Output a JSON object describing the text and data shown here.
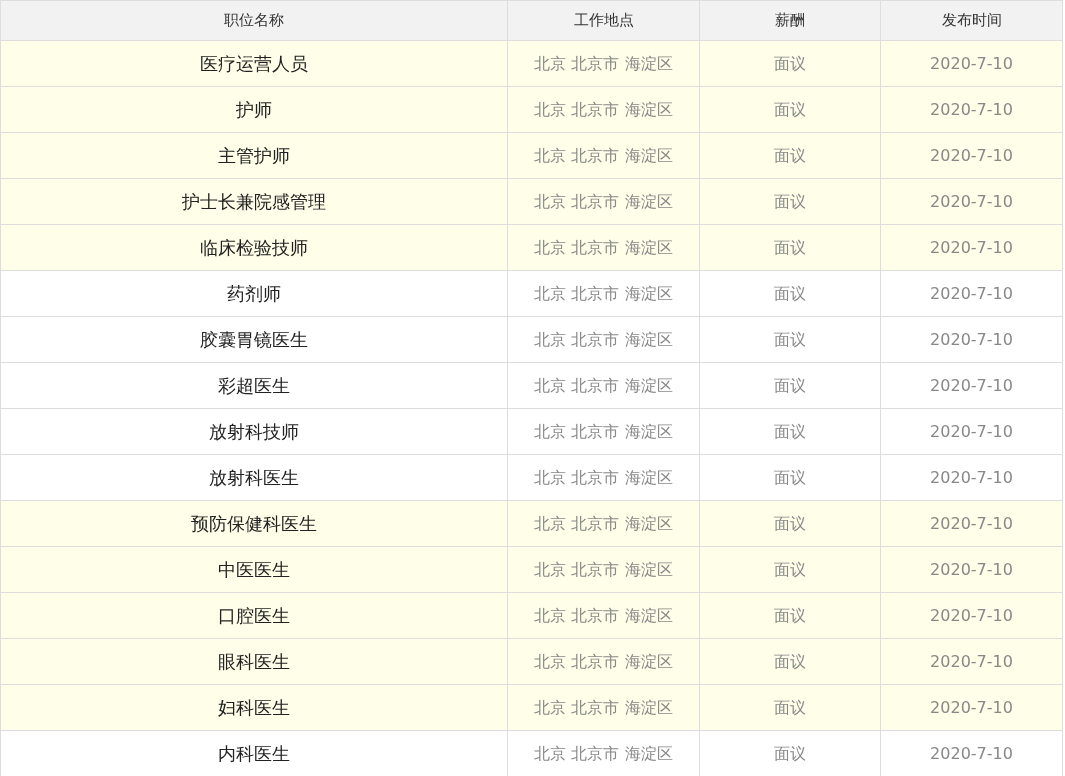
{
  "table": {
    "columns": [
      "职位名称",
      "工作地点",
      "薪酬",
      "发布时间"
    ],
    "rows": [
      {
        "title": "医疗运营人员",
        "location": "北京 北京市 海淀区",
        "salary": "面议",
        "date": "2020-7-10",
        "highlighted": true
      },
      {
        "title": "护师",
        "location": "北京 北京市 海淀区",
        "salary": "面议",
        "date": "2020-7-10",
        "highlighted": true
      },
      {
        "title": "主管护师",
        "location": "北京 北京市 海淀区",
        "salary": "面议",
        "date": "2020-7-10",
        "highlighted": true
      },
      {
        "title": "护士长兼院感管理",
        "location": "北京 北京市 海淀区",
        "salary": "面议",
        "date": "2020-7-10",
        "highlighted": true
      },
      {
        "title": "临床检验技师",
        "location": "北京 北京市 海淀区",
        "salary": "面议",
        "date": "2020-7-10",
        "highlighted": true
      },
      {
        "title": "药剂师",
        "location": "北京 北京市 海淀区",
        "salary": "面议",
        "date": "2020-7-10",
        "highlighted": false
      },
      {
        "title": "胶囊胃镜医生",
        "location": "北京 北京市 海淀区",
        "salary": "面议",
        "date": "2020-7-10",
        "highlighted": false
      },
      {
        "title": "彩超医生",
        "location": "北京 北京市 海淀区",
        "salary": "面议",
        "date": "2020-7-10",
        "highlighted": false
      },
      {
        "title": "放射科技师",
        "location": "北京 北京市 海淀区",
        "salary": "面议",
        "date": "2020-7-10",
        "highlighted": false
      },
      {
        "title": "放射科医生",
        "location": "北京 北京市 海淀区",
        "salary": "面议",
        "date": "2020-7-10",
        "highlighted": false
      },
      {
        "title": "预防保健科医生",
        "location": "北京 北京市 海淀区",
        "salary": "面议",
        "date": "2020-7-10",
        "highlighted": true
      },
      {
        "title": "中医医生",
        "location": "北京 北京市 海淀区",
        "salary": "面议",
        "date": "2020-7-10",
        "highlighted": true
      },
      {
        "title": "口腔医生",
        "location": "北京 北京市 海淀区",
        "salary": "面议",
        "date": "2020-7-10",
        "highlighted": true
      },
      {
        "title": "眼科医生",
        "location": "北京 北京市 海淀区",
        "salary": "面议",
        "date": "2020-7-10",
        "highlighted": true
      },
      {
        "title": "妇科医生",
        "location": "北京 北京市 海淀区",
        "salary": "面议",
        "date": "2020-7-10",
        "highlighted": true
      },
      {
        "title": "内科医生",
        "location": "北京 北京市 海淀区",
        "salary": "面议",
        "date": "2020-7-10",
        "highlighted": false
      }
    ]
  }
}
